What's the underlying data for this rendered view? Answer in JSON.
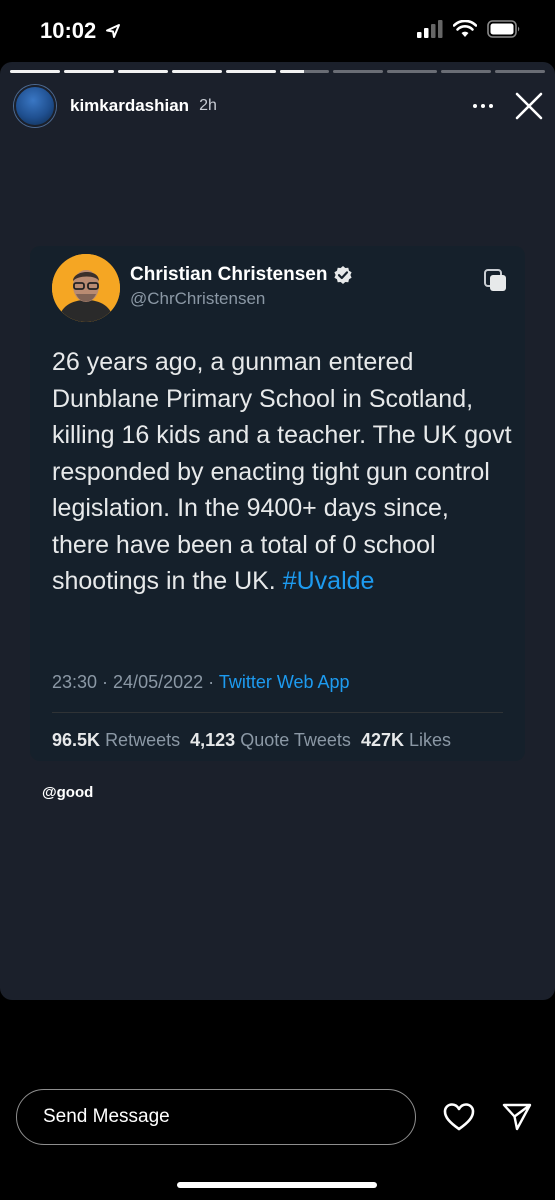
{
  "status_bar": {
    "time": "10:02",
    "icons": [
      "location-arrow-icon",
      "signal-icon",
      "wifi-icon",
      "battery-icon"
    ]
  },
  "story": {
    "progress": {
      "segments": 10,
      "completed": 5,
      "current_fraction": 0.5
    },
    "username": "kimkardashian",
    "time_ago": "2h",
    "tag": "@good"
  },
  "tweet": {
    "name": "Christian Christensen",
    "handle": "@ChrChristensen",
    "text": "26 years ago, a gunman entered Dunblane Primary School in Scotland, killing 16 kids and a teacher. The UK govt responded by enacting tight gun control legislation. In the 9400+ days since, there have been a total of 0 school shootings in the UK.",
    "hashtag": "#Uvalde",
    "timestamp": "23:30 · 24/05/2022 ·",
    "source": "Twitter Web App",
    "stats": {
      "retweets_count": "96.5K",
      "retweets_label": "Retweets",
      "quotes_count": "4,123",
      "quotes_label": "Quote Tweets",
      "likes_count": "427K",
      "likes_label": "Likes"
    }
  },
  "footer": {
    "message_placeholder": "Send Message"
  },
  "colors": {
    "story_background": "#1b202b",
    "tweet_background": "#15202b",
    "link_blue": "#1d9bf0",
    "muted_text": "#8b98a5"
  }
}
